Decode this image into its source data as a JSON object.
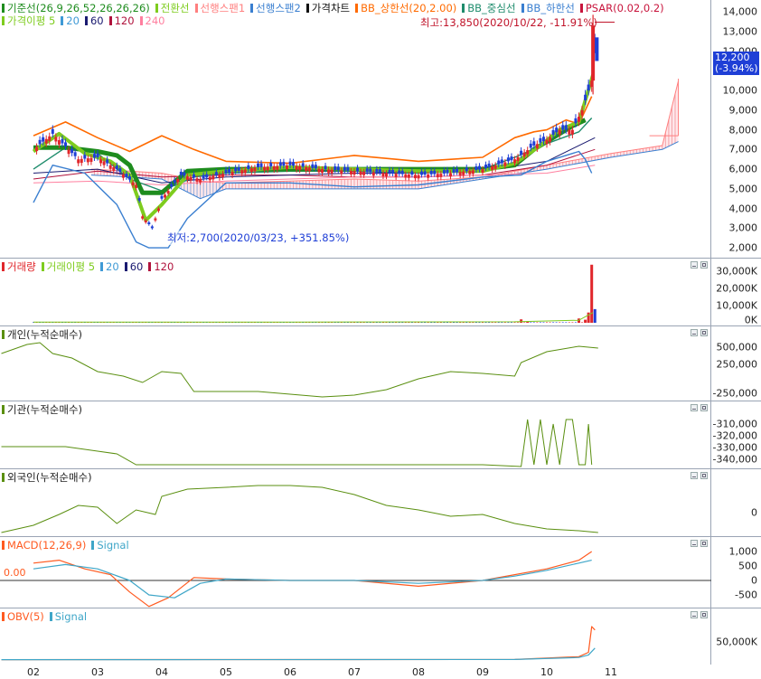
{
  "colors": {
    "candle_up": "#e0262b",
    "candle_down": "#1f3fd6",
    "kijun": "#1e8c1e",
    "tenkan": "#ff7f7f",
    "span1": "#ff7f7f",
    "span2": "#3a7fd0",
    "price_line": "#111111",
    "bb_upper": "#ff6a00",
    "bb_mid": "#1e8c6c",
    "bb_lower": "#3a7fd0",
    "psar": "#c8143c",
    "ma5": "#7ecc1e",
    "ma20": "#3f9ad6",
    "ma60": "#1a1a70",
    "ma120": "#b0123c",
    "ma240": "#ff7f9f",
    "vol_up": "#e0262b",
    "vol_down": "#1f3fd6",
    "flow_line": "#5a8f10",
    "macd": "#ff5a20",
    "macd_signal": "#3fa6c8",
    "obv": "#ff5a20",
    "obv_signal": "#3fa6c8"
  },
  "price_panel": {
    "legend": [
      {
        "icon": "kijun-marker",
        "text": "기준선(26,9,26,52,26,26,26)",
        "color": "#1e8c1e"
      },
      {
        "icon": "tenkan-marker",
        "text": "전환선",
        "color": "#7ecc1e"
      },
      {
        "icon": "span1-marker",
        "text": "선행스팬1",
        "color": "#ff7f7f"
      },
      {
        "icon": "span2-marker",
        "text": "선행스팬2",
        "color": "#3a7fd0"
      },
      {
        "icon": "price-marker",
        "text": "가격차트",
        "color": "#111111"
      },
      {
        "icon": "bb-upper-marker",
        "text": "BB_상한선(20,2.00)",
        "color": "#ff6a00"
      },
      {
        "icon": "bb-mid-marker",
        "text": "BB_중심선",
        "color": "#1e8c6c"
      },
      {
        "icon": "bb-lower-marker",
        "text": "BB_하한선",
        "color": "#3a7fd0"
      },
      {
        "icon": "psar-marker",
        "text": "PSAR(0.02,0.2)",
        "color": "#c8143c"
      }
    ],
    "legend2": [
      {
        "icon": "ma-marker",
        "text": "가격이평 5",
        "color": "#7ecc1e"
      },
      {
        "icon": "ma20-marker",
        "text": "20",
        "color": "#3f9ad6"
      },
      {
        "icon": "ma60-marker",
        "text": "60",
        "color": "#1a1a70"
      },
      {
        "icon": "ma120-marker",
        "text": "120",
        "color": "#b0123c"
      },
      {
        "icon": "ma240-marker",
        "text": "240",
        "color": "#ff7f9f"
      }
    ],
    "high_label": "최고:13,850(2020/10/22, -11.91%)",
    "low_label": "최저:2,700(2020/03/23, +351.85%)",
    "current_price": "12,200",
    "current_change": "(-3.94%)",
    "y_ticks": [
      "14,000",
      "13,000",
      "12,000",
      "11,000",
      "10,000",
      "9,000",
      "8,000",
      "7,000",
      "6,000",
      "5,000",
      "4,000",
      "3,000",
      "2,000"
    ],
    "ylim": [
      1500,
      14600
    ]
  },
  "volume_panel": {
    "legend": [
      {
        "icon": "volume-marker",
        "text": "거래량",
        "color": "#e0262b"
      },
      {
        "icon": "vol-ma-marker",
        "text": "거래이평 5",
        "color": "#7ecc1e"
      },
      {
        "icon": "vol-ma20-marker",
        "text": "20",
        "color": "#3f9ad6"
      },
      {
        "icon": "vol-ma60-marker",
        "text": "60",
        "color": "#1a1a70"
      },
      {
        "icon": "vol-ma120-marker",
        "text": "120",
        "color": "#b0123c"
      }
    ],
    "y_ticks": [
      "30,000K",
      "20,000K",
      "10,000K",
      "0K"
    ]
  },
  "individual_panel": {
    "legend": "개인(누적순매수)",
    "y_ticks": [
      "500,000",
      "250,000",
      "-250,000"
    ]
  },
  "institution_panel": {
    "legend": "기관(누적순매수)",
    "y_ticks": [
      "-310,000",
      "-320,000",
      "-330,000",
      "-340,000"
    ]
  },
  "foreign_panel": {
    "legend": "외국인(누적순매수)",
    "y_ticks": [
      "0"
    ]
  },
  "macd_panel": {
    "legend": [
      {
        "icon": "macd-marker",
        "text": "MACD(12,26,9)",
        "color": "#ff5a20"
      },
      {
        "icon": "signal-marker",
        "text": "Signal",
        "color": "#3fa6c8"
      }
    ],
    "zero_label": "0.00",
    "y_ticks": [
      "1,000",
      "500",
      "0",
      "-500"
    ]
  },
  "obv_panel": {
    "legend": [
      {
        "icon": "obv-marker",
        "text": "OBV(5)",
        "color": "#ff5a20"
      },
      {
        "icon": "obv-signal-marker",
        "text": "Signal",
        "color": "#3fa6c8"
      }
    ],
    "y_ticks": [
      "50,000K"
    ]
  },
  "x_axis": [
    "02",
    "03",
    "04",
    "05",
    "06",
    "07",
    "08",
    "09",
    "10",
    "11"
  ],
  "chart_data": {
    "type": "line",
    "title": "",
    "x_months": [
      "02",
      "03",
      "04",
      "05",
      "06",
      "07",
      "08",
      "09",
      "10",
      "11"
    ],
    "series": [
      {
        "name": "가격차트",
        "x_month_index": [
          0,
          0.3,
          0.7,
          1.0,
          1.3,
          1.6,
          1.7,
          1.85,
          2.0,
          2.3,
          2.6,
          3.0,
          3.5,
          4.0,
          4.5,
          5.0,
          5.5,
          6.0,
          6.5,
          7.0,
          7.5,
          7.8,
          8.0,
          8.2,
          8.4,
          8.55,
          8.7,
          8.72,
          8.75
        ],
        "values": [
          7000,
          7800,
          6500,
          6600,
          6000,
          5200,
          3600,
          3000,
          4500,
          5700,
          5500,
          5800,
          6100,
          6200,
          6000,
          5900,
          5800,
          5700,
          5800,
          6000,
          6500,
          7200,
          7500,
          8000,
          8000,
          9000,
          10500,
          12900,
          12200
        ]
      },
      {
        "name": "BB_상한선(20,2.00)",
        "x_month_index": [
          0,
          0.5,
          1.0,
          1.5,
          2.0,
          2.5,
          3.0,
          4.0,
          5.0,
          6.0,
          7.0,
          7.5,
          7.8,
          8.0,
          8.3,
          8.5,
          8.7
        ],
        "values": [
          7700,
          8400,
          7600,
          6900,
          7700,
          7000,
          6400,
          6300,
          6700,
          6400,
          6600,
          7600,
          7900,
          8000,
          8500,
          8300,
          9700
        ]
      },
      {
        "name": "BB_하한선",
        "x_month_index": [
          0,
          0.3,
          0.8,
          1.3,
          1.6,
          1.8,
          2.1,
          2.4,
          3.0,
          4.0,
          5.0,
          6.0,
          7.0,
          7.6,
          8.0,
          8.5,
          8.6,
          8.7
        ],
        "values": [
          4300,
          6200,
          5800,
          4200,
          2300,
          2000,
          2000,
          3500,
          5300,
          5300,
          5100,
          5200,
          5600,
          5700,
          6400,
          6900,
          6500,
          5800
        ]
      },
      {
        "name": "기준선(26,9,26,52,26,26,26)",
        "x_month_index": [
          0,
          0.5,
          1.0,
          1.3,
          1.5,
          1.7,
          2.0,
          2.4,
          3.0,
          4.0,
          5.0,
          6.0,
          7.0,
          7.5,
          7.8,
          8.1,
          8.4,
          8.6
        ],
        "values": [
          7100,
          7100,
          6900,
          6700,
          6200,
          4800,
          4800,
          5900,
          6000,
          6000,
          6000,
          6000,
          6000,
          6200,
          7000,
          7600,
          8200,
          8500
        ]
      },
      {
        "name": "거래량",
        "x_month_index": [
          7.6,
          7.7,
          8.5,
          8.6,
          8.65,
          8.7,
          8.75
        ],
        "values": [
          2000,
          800,
          2500,
          1800,
          6000,
          34000,
          8000
        ]
      },
      {
        "name": "MACD(12,26,9)",
        "x_month_index": [
          0,
          0.4,
          0.8,
          1.2,
          1.5,
          1.8,
          2.1,
          2.5,
          3.0,
          4.0,
          5.0,
          6.0,
          7.0,
          7.5,
          8.0,
          8.5,
          8.7
        ],
        "values": [
          600,
          700,
          400,
          200,
          -400,
          -900,
          -600,
          100,
          50,
          0,
          0,
          -200,
          0,
          200,
          400,
          700,
          1000
        ]
      }
    ],
    "ylim": [
      1500,
      14600
    ],
    "ylabel": "",
    "xlabel": ""
  }
}
